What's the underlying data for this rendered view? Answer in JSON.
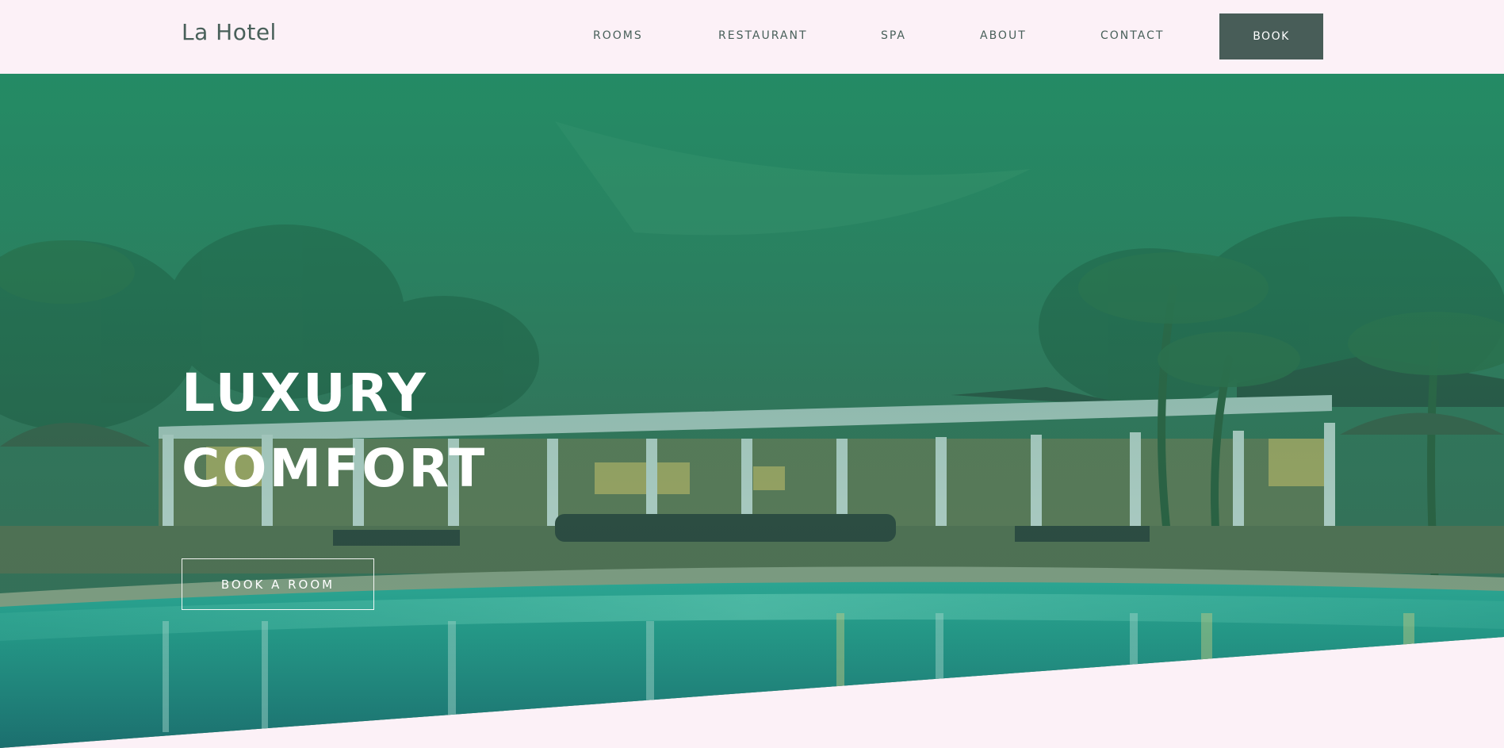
{
  "header": {
    "logo": "La Hotel",
    "nav": {
      "rooms": "ROOMS",
      "restaurant": "RESTAURANT",
      "spa": "SPA",
      "about": "ABOUT",
      "contact": "CONTACT"
    },
    "book_label": "BOOK"
  },
  "hero": {
    "title_line1": "LUXURY",
    "title_line2": "COMFORT",
    "cta_label": "BOOK A ROOM"
  },
  "colors": {
    "background": "#fcf1f7",
    "brand_dark": "#485d58",
    "hero_tint": "#1f8c64",
    "text_light": "#ffffff"
  }
}
